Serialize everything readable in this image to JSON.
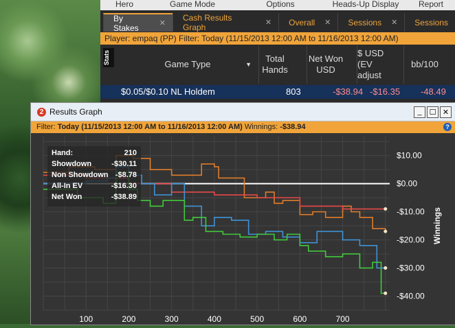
{
  "menu": [
    "Hero",
    "Game Mode",
    "Options",
    "Heads-Up Display",
    "Report"
  ],
  "tabs": [
    {
      "label": "By Stakes",
      "active": true
    },
    {
      "label": "Cash Results Graph"
    },
    {
      "label": "Overall"
    },
    {
      "label": "Sessions"
    },
    {
      "label": "Sessions"
    }
  ],
  "filter": "Player: empaq (PP)   Filter: Today (11/15/2013 12:00 AM to 11/16/2013 12:00 AM)",
  "stats_label": "Stats",
  "columns": {
    "game_type": "Game Type",
    "total_hands": "Total Hands",
    "net_won": "Net Won USD",
    "ev": "$ USD (EV adjust",
    "bb100": "bb/100"
  },
  "row": {
    "game": "$0.05/$0.10 NL Holdem",
    "hands": "803",
    "net_won": "-$38.94",
    "ev": "-$16.35",
    "bb100": "-48.49"
  },
  "results_window": {
    "title": "Results Graph",
    "filter_prefix": "Filter: ",
    "filter_value": "Today (11/15/2013 12:00 AM to 11/16/2013 12:00 AM)",
    "winnings_label": " Winnings: ",
    "winnings_value": "-$38.94"
  },
  "summary": {
    "hand_label": "Hand:",
    "hand_value": "210",
    "showdown_label": "Showdown",
    "showdown_value": "-$30.11",
    "nonshowdown_label": "Non Showdown",
    "nonshowdown_value": "-$8.78",
    "allin_label": "All-In EV",
    "allin_value": "-$16.30",
    "netwon_label": "Net Won",
    "netwon_value": "-$38.89"
  },
  "chart_data": {
    "type": "line",
    "ylabel": "Winnings",
    "ylim": [
      -45,
      17
    ],
    "xlim": [
      0,
      810
    ],
    "x_ticks": [
      "100",
      "200",
      "300",
      "400",
      "500",
      "600",
      "700"
    ],
    "y_ticks": [
      "$10.00",
      "$0.00",
      "-$10.00",
      "-$20.00",
      "-$30.00",
      "-$40.00"
    ],
    "series": [
      {
        "color": "#e07c2a",
        "x": [
          0,
          60,
          120,
          170,
          210,
          250,
          300,
          370,
          400,
          410,
          470,
          520,
          540,
          560,
          600,
          630,
          660,
          700,
          720,
          740,
          770,
          800
        ],
        "y": [
          4,
          6,
          5,
          10,
          9,
          5,
          3,
          7,
          6,
          2,
          -5,
          -3,
          -7,
          -6,
          -11,
          -10,
          -12,
          -8,
          -10,
          -12,
          -16,
          -17
        ]
      },
      {
        "color": "#e84848",
        "x": [
          0,
          100,
          200,
          300,
          400,
          500,
          600,
          700,
          760,
          800
        ],
        "y": [
          3,
          2,
          0,
          -3,
          -4,
          -5,
          -8,
          -9,
          -9,
          -9
        ]
      },
      {
        "color": "#3f93d6",
        "x": [
          0,
          100,
          150,
          170,
          200,
          230,
          260,
          300,
          330,
          370,
          400,
          440,
          480,
          520,
          560,
          600,
          640,
          700,
          740,
          780,
          800
        ],
        "y": [
          0,
          1,
          2,
          6,
          3,
          0,
          -4,
          0,
          -8,
          -15,
          -12,
          -13,
          -18,
          -17,
          -19,
          -21,
          -17,
          -20,
          -22,
          -30,
          -30
        ]
      },
      {
        "color": "#41c93c",
        "x": [
          0,
          80,
          140,
          170,
          200,
          220,
          250,
          280,
          330,
          350,
          380,
          420,
          460,
          500,
          540,
          570,
          600,
          620,
          660,
          700,
          740,
          770,
          790,
          800
        ],
        "y": [
          -2,
          -5,
          -7,
          4,
          -2,
          -6,
          -8,
          -6,
          -13,
          -12,
          -17,
          -18,
          -19,
          -18,
          -20,
          -18,
          -22,
          -24,
          -26,
          -25,
          -30,
          -28,
          -39,
          -39
        ]
      }
    ]
  }
}
